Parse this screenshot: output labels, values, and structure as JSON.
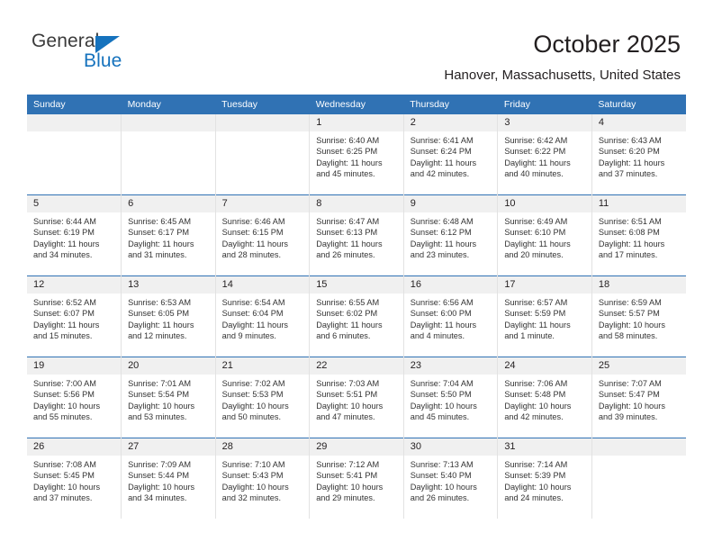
{
  "brand": {
    "name_top": "General",
    "name_bottom": "Blue",
    "accent_color": "#1572bd",
    "triangle_icon": "triangle-icon"
  },
  "header": {
    "title": "October 2025",
    "subtitle": "Hanover, Massachusetts, United States"
  },
  "theme": {
    "header_blue": "#3072b4",
    "daynum_strip": "#f0f0f0",
    "text": "#231f20"
  },
  "calendar": {
    "weekday_headers": [
      "Sunday",
      "Monday",
      "Tuesday",
      "Wednesday",
      "Thursday",
      "Friday",
      "Saturday"
    ],
    "labels": {
      "sunrise": "Sunrise:",
      "sunset": "Sunset:",
      "daylight": "Daylight:"
    },
    "weeks": [
      [
        {
          "day": "",
          "blank": true
        },
        {
          "day": "",
          "blank": true
        },
        {
          "day": "",
          "blank": true
        },
        {
          "day": "1",
          "sunrise": "Sunrise: 6:40 AM",
          "sunset": "Sunset: 6:25 PM",
          "daylight1": "Daylight: 11 hours",
          "daylight2": "and 45 minutes."
        },
        {
          "day": "2",
          "sunrise": "Sunrise: 6:41 AM",
          "sunset": "Sunset: 6:24 PM",
          "daylight1": "Daylight: 11 hours",
          "daylight2": "and 42 minutes."
        },
        {
          "day": "3",
          "sunrise": "Sunrise: 6:42 AM",
          "sunset": "Sunset: 6:22 PM",
          "daylight1": "Daylight: 11 hours",
          "daylight2": "and 40 minutes."
        },
        {
          "day": "4",
          "sunrise": "Sunrise: 6:43 AM",
          "sunset": "Sunset: 6:20 PM",
          "daylight1": "Daylight: 11 hours",
          "daylight2": "and 37 minutes."
        }
      ],
      [
        {
          "day": "5",
          "sunrise": "Sunrise: 6:44 AM",
          "sunset": "Sunset: 6:19 PM",
          "daylight1": "Daylight: 11 hours",
          "daylight2": "and 34 minutes."
        },
        {
          "day": "6",
          "sunrise": "Sunrise: 6:45 AM",
          "sunset": "Sunset: 6:17 PM",
          "daylight1": "Daylight: 11 hours",
          "daylight2": "and 31 minutes."
        },
        {
          "day": "7",
          "sunrise": "Sunrise: 6:46 AM",
          "sunset": "Sunset: 6:15 PM",
          "daylight1": "Daylight: 11 hours",
          "daylight2": "and 28 minutes."
        },
        {
          "day": "8",
          "sunrise": "Sunrise: 6:47 AM",
          "sunset": "Sunset: 6:13 PM",
          "daylight1": "Daylight: 11 hours",
          "daylight2": "and 26 minutes."
        },
        {
          "day": "9",
          "sunrise": "Sunrise: 6:48 AM",
          "sunset": "Sunset: 6:12 PM",
          "daylight1": "Daylight: 11 hours",
          "daylight2": "and 23 minutes."
        },
        {
          "day": "10",
          "sunrise": "Sunrise: 6:49 AM",
          "sunset": "Sunset: 6:10 PM",
          "daylight1": "Daylight: 11 hours",
          "daylight2": "and 20 minutes."
        },
        {
          "day": "11",
          "sunrise": "Sunrise: 6:51 AM",
          "sunset": "Sunset: 6:08 PM",
          "daylight1": "Daylight: 11 hours",
          "daylight2": "and 17 minutes."
        }
      ],
      [
        {
          "day": "12",
          "sunrise": "Sunrise: 6:52 AM",
          "sunset": "Sunset: 6:07 PM",
          "daylight1": "Daylight: 11 hours",
          "daylight2": "and 15 minutes."
        },
        {
          "day": "13",
          "sunrise": "Sunrise: 6:53 AM",
          "sunset": "Sunset: 6:05 PM",
          "daylight1": "Daylight: 11 hours",
          "daylight2": "and 12 minutes."
        },
        {
          "day": "14",
          "sunrise": "Sunrise: 6:54 AM",
          "sunset": "Sunset: 6:04 PM",
          "daylight1": "Daylight: 11 hours",
          "daylight2": "and 9 minutes."
        },
        {
          "day": "15",
          "sunrise": "Sunrise: 6:55 AM",
          "sunset": "Sunset: 6:02 PM",
          "daylight1": "Daylight: 11 hours",
          "daylight2": "and 6 minutes."
        },
        {
          "day": "16",
          "sunrise": "Sunrise: 6:56 AM",
          "sunset": "Sunset: 6:00 PM",
          "daylight1": "Daylight: 11 hours",
          "daylight2": "and 4 minutes."
        },
        {
          "day": "17",
          "sunrise": "Sunrise: 6:57 AM",
          "sunset": "Sunset: 5:59 PM",
          "daylight1": "Daylight: 11 hours",
          "daylight2": "and 1 minute."
        },
        {
          "day": "18",
          "sunrise": "Sunrise: 6:59 AM",
          "sunset": "Sunset: 5:57 PM",
          "daylight1": "Daylight: 10 hours",
          "daylight2": "and 58 minutes."
        }
      ],
      [
        {
          "day": "19",
          "sunrise": "Sunrise: 7:00 AM",
          "sunset": "Sunset: 5:56 PM",
          "daylight1": "Daylight: 10 hours",
          "daylight2": "and 55 minutes."
        },
        {
          "day": "20",
          "sunrise": "Sunrise: 7:01 AM",
          "sunset": "Sunset: 5:54 PM",
          "daylight1": "Daylight: 10 hours",
          "daylight2": "and 53 minutes."
        },
        {
          "day": "21",
          "sunrise": "Sunrise: 7:02 AM",
          "sunset": "Sunset: 5:53 PM",
          "daylight1": "Daylight: 10 hours",
          "daylight2": "and 50 minutes."
        },
        {
          "day": "22",
          "sunrise": "Sunrise: 7:03 AM",
          "sunset": "Sunset: 5:51 PM",
          "daylight1": "Daylight: 10 hours",
          "daylight2": "and 47 minutes."
        },
        {
          "day": "23",
          "sunrise": "Sunrise: 7:04 AM",
          "sunset": "Sunset: 5:50 PM",
          "daylight1": "Daylight: 10 hours",
          "daylight2": "and 45 minutes."
        },
        {
          "day": "24",
          "sunrise": "Sunrise: 7:06 AM",
          "sunset": "Sunset: 5:48 PM",
          "daylight1": "Daylight: 10 hours",
          "daylight2": "and 42 minutes."
        },
        {
          "day": "25",
          "sunrise": "Sunrise: 7:07 AM",
          "sunset": "Sunset: 5:47 PM",
          "daylight1": "Daylight: 10 hours",
          "daylight2": "and 39 minutes."
        }
      ],
      [
        {
          "day": "26",
          "sunrise": "Sunrise: 7:08 AM",
          "sunset": "Sunset: 5:45 PM",
          "daylight1": "Daylight: 10 hours",
          "daylight2": "and 37 minutes."
        },
        {
          "day": "27",
          "sunrise": "Sunrise: 7:09 AM",
          "sunset": "Sunset: 5:44 PM",
          "daylight1": "Daylight: 10 hours",
          "daylight2": "and 34 minutes."
        },
        {
          "day": "28",
          "sunrise": "Sunrise: 7:10 AM",
          "sunset": "Sunset: 5:43 PM",
          "daylight1": "Daylight: 10 hours",
          "daylight2": "and 32 minutes."
        },
        {
          "day": "29",
          "sunrise": "Sunrise: 7:12 AM",
          "sunset": "Sunset: 5:41 PM",
          "daylight1": "Daylight: 10 hours",
          "daylight2": "and 29 minutes."
        },
        {
          "day": "30",
          "sunrise": "Sunrise: 7:13 AM",
          "sunset": "Sunset: 5:40 PM",
          "daylight1": "Daylight: 10 hours",
          "daylight2": "and 26 minutes."
        },
        {
          "day": "31",
          "sunrise": "Sunrise: 7:14 AM",
          "sunset": "Sunset: 5:39 PM",
          "daylight1": "Daylight: 10 hours",
          "daylight2": "and 24 minutes."
        },
        {
          "day": "",
          "blank": true
        }
      ]
    ]
  }
}
